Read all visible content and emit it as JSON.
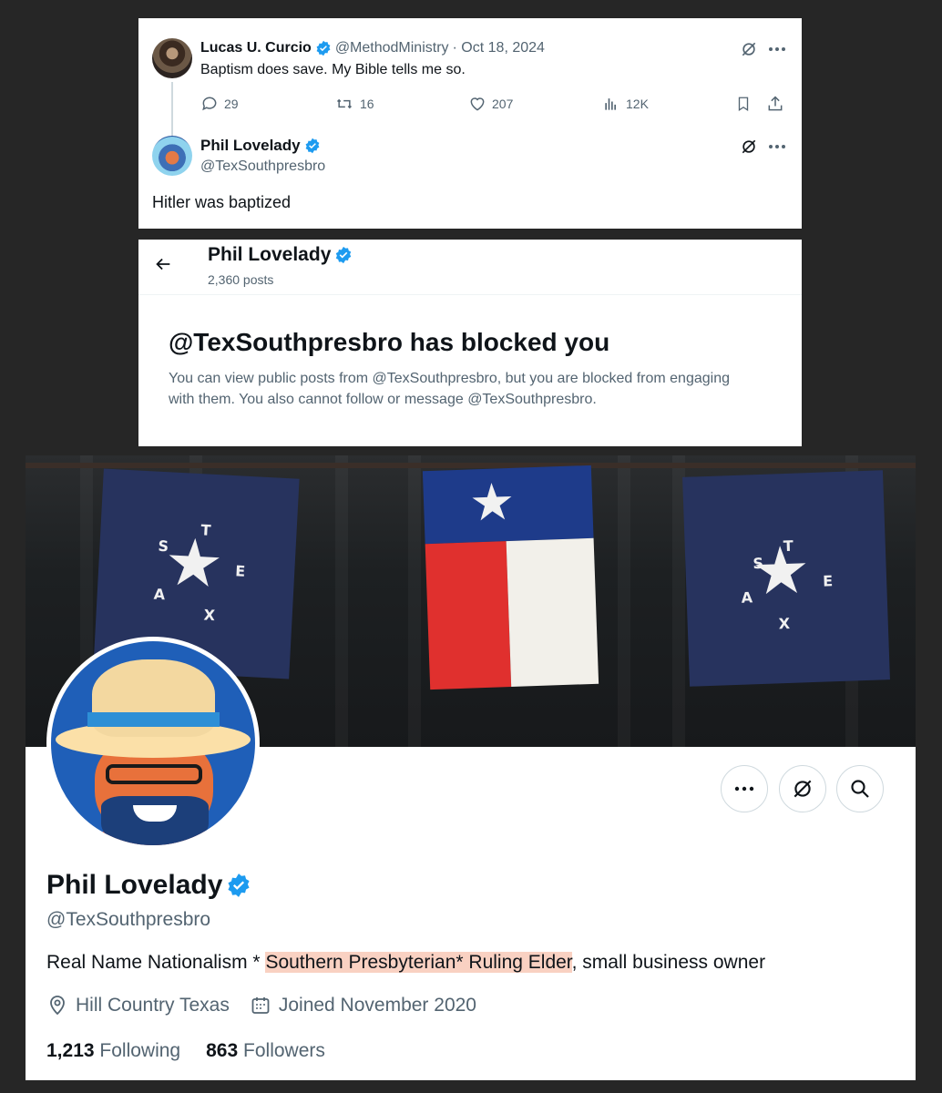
{
  "tweet": {
    "author_name": "Lucas U. Curcio",
    "author_handle": "@MethodMinistry",
    "date": "· Oct 18, 2024",
    "text": "Baptism does save. My Bible tells me so.",
    "replies": "29",
    "retweets": "16",
    "likes": "207",
    "views": "12K"
  },
  "reply": {
    "author_name": "Phil Lovelady",
    "author_handle": "@TexSouthpresbro",
    "text": "Hitler was baptized"
  },
  "blocked": {
    "profile_name": "Phil Lovelady",
    "posts_count": "2,360 posts",
    "title": "@TexSouthpresbro has blocked you",
    "description": "You can view public posts from @TexSouthpresbro, but you are blocked from engaging with them. You also cannot follow or message @TexSouthpresbro."
  },
  "profile": {
    "name": "Phil Lovelady",
    "handle": "@TexSouthpresbro",
    "bio_prefix": "Real Name Nationalism * ",
    "bio_highlight": "Southern Presbyterian* Ruling Elder",
    "bio_suffix": ", small business owner",
    "location": "Hill Country Texas",
    "joined": "Joined November 2020",
    "following_count": "1,213",
    "following_label": "Following",
    "followers_count": "863",
    "followers_label": "Followers",
    "banner_flag_letters": [
      "T",
      "E",
      "X",
      "A",
      "S"
    ]
  },
  "icons": {
    "verified": "verified-badge-icon",
    "grok": "grok-icon",
    "more": "more-icon",
    "reply": "reply-icon",
    "retweet": "retweet-icon",
    "like": "like-icon",
    "views": "views-icon",
    "bookmark": "bookmark-icon",
    "share": "share-icon",
    "back": "back-arrow-icon",
    "search": "search-icon",
    "location": "location-icon",
    "calendar": "calendar-icon"
  },
  "colors": {
    "verified_blue": "#1d9bf0",
    "muted_text": "#536471",
    "bio_highlight": "#f9d1c2",
    "page_background": "#262626"
  }
}
